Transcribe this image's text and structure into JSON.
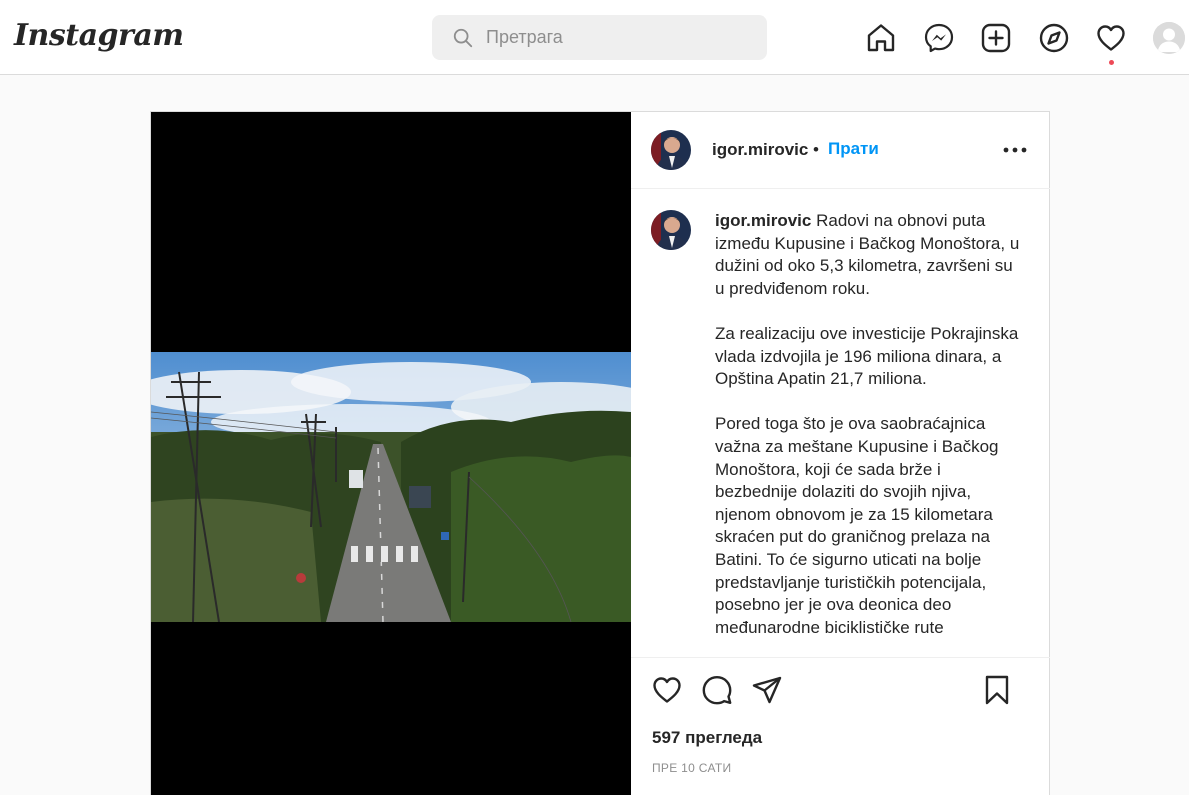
{
  "brand": {
    "logo_text": "Instagram"
  },
  "search": {
    "placeholder": "Претрага",
    "value": ""
  },
  "nav": {
    "icons": [
      "home-icon",
      "messenger-icon",
      "new-post-icon",
      "explore-icon",
      "activity-heart-icon",
      "profile-avatar"
    ],
    "notification_dot_color": "#ed4956"
  },
  "post": {
    "username": "igor.mirovic",
    "separator": "•",
    "follow_label": "Прати",
    "caption": {
      "username": "igor.mirovic",
      "paragraphs": [
        "Radovi na obnovi puta između Kupusine i Bačkog Monoštora, u dužini od oko 5,3 kilometra, završeni su u predviđenom roku.",
        "Za realizaciju ove investicije Pokrajinska vlada izdvojila je 196 miliona dinara, a Opština Apatin 21,7 miliona.",
        "Pored toga što je ova saobraćajnica važna za meštane Kupusine i Bačkog Monoštora, koji će sada brže i bezbednije dolaziti do svojih njiva, njenom obnovom je za 15 kilometara skraćen put do graničnog prelaza na Batini. To će sigurno uticati na bolje predstavljanje turističkih potencijala, posebno jer je ova deonica deo međunarodne biciklističke rute"
      ]
    },
    "views_label": "597 прегледа",
    "time_label": "ПРЕ 10 САТИ"
  },
  "colors": {
    "accent": "#0095f6",
    "text": "#262626",
    "muted": "#8e8e8e",
    "border": "#dbdbdb",
    "background": "#fafafa"
  }
}
